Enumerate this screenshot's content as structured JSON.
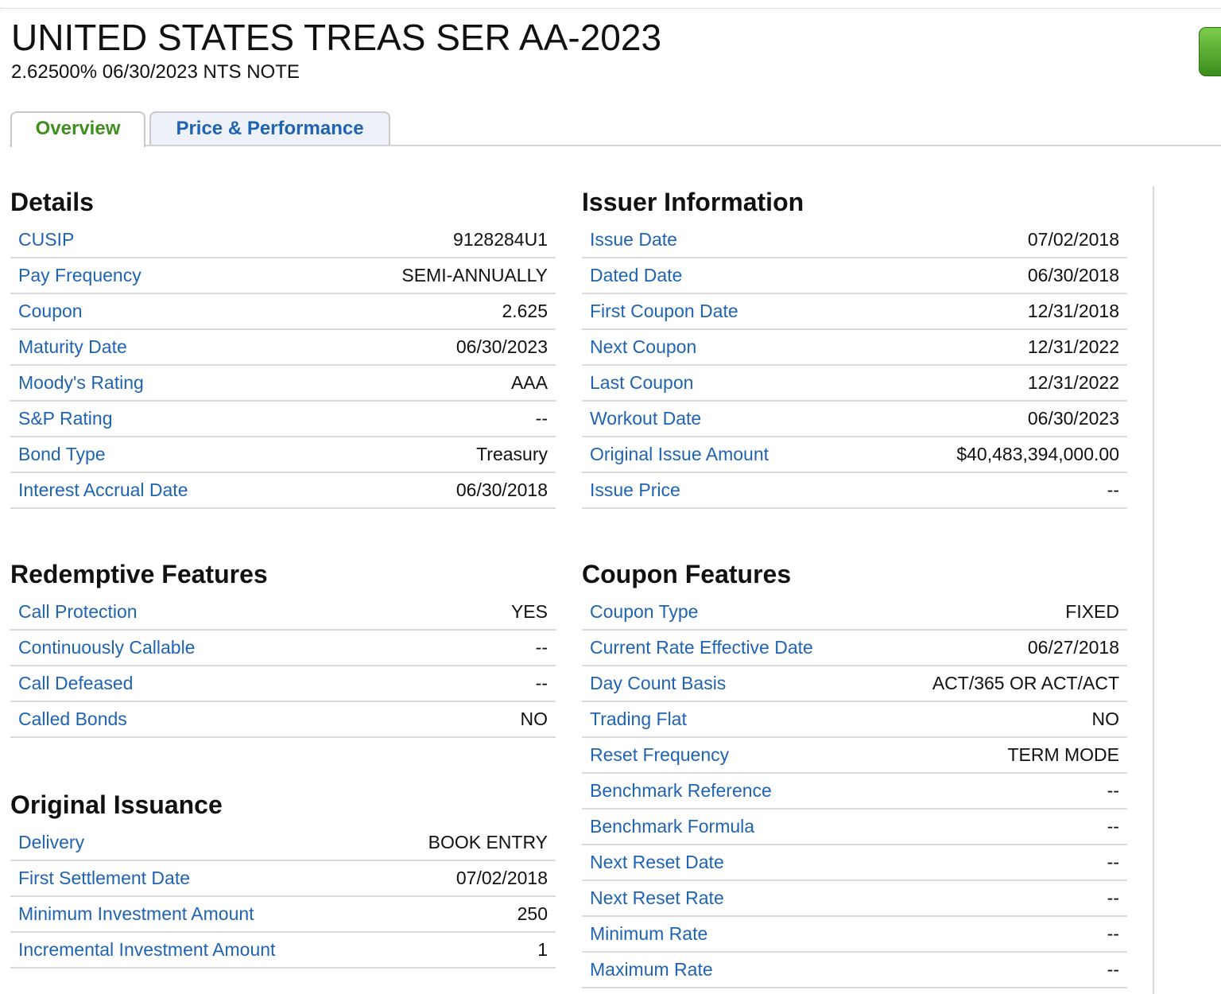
{
  "header": {
    "title": "UNITED STATES TREAS SER AA-2023",
    "subtitle": "2.62500% 06/30/2023 NTS NOTE"
  },
  "tabs": [
    {
      "label": "Overview",
      "active": true
    },
    {
      "label": "Price & Performance",
      "active": false
    }
  ],
  "details": {
    "heading": "Details",
    "rows": [
      {
        "label": "CUSIP",
        "value": "9128284U1"
      },
      {
        "label": "Pay Frequency",
        "value": "SEMI-ANNUALLY"
      },
      {
        "label": "Coupon",
        "value": "2.625"
      },
      {
        "label": "Maturity Date",
        "value": "06/30/2023"
      },
      {
        "label": "Moody's Rating",
        "value": "AAA"
      },
      {
        "label": "S&P Rating",
        "value": "--"
      },
      {
        "label": "Bond Type",
        "value": "Treasury"
      },
      {
        "label": "Interest Accrual Date",
        "value": "06/30/2018"
      }
    ]
  },
  "issuer": {
    "heading": "Issuer Information",
    "rows": [
      {
        "label": "Issue Date",
        "value": "07/02/2018"
      },
      {
        "label": "Dated Date",
        "value": "06/30/2018"
      },
      {
        "label": "First Coupon Date",
        "value": "12/31/2018"
      },
      {
        "label": "Next Coupon",
        "value": "12/31/2022"
      },
      {
        "label": "Last Coupon",
        "value": "12/31/2022"
      },
      {
        "label": "Workout Date",
        "value": "06/30/2023"
      },
      {
        "label": "Original Issue Amount",
        "value": "$40,483,394,000.00"
      },
      {
        "label": "Issue Price",
        "value": "--"
      }
    ]
  },
  "redemptive": {
    "heading": "Redemptive Features",
    "rows": [
      {
        "label": "Call Protection",
        "value": "YES"
      },
      {
        "label": "Continuously Callable",
        "value": "--"
      },
      {
        "label": "Call Defeased",
        "value": "--"
      },
      {
        "label": "Called Bonds",
        "value": "NO"
      }
    ]
  },
  "coupon": {
    "heading": "Coupon Features",
    "rows": [
      {
        "label": "Coupon Type",
        "value": "FIXED"
      },
      {
        "label": "Current Rate Effective Date",
        "value": "06/27/2018"
      },
      {
        "label": "Day Count Basis",
        "value": "ACT/365 OR ACT/ACT"
      },
      {
        "label": "Trading Flat",
        "value": "NO"
      },
      {
        "label": "Reset Frequency",
        "value": "TERM MODE"
      },
      {
        "label": "Benchmark Reference",
        "value": "--"
      },
      {
        "label": "Benchmark Formula",
        "value": "--"
      },
      {
        "label": "Next Reset Date",
        "value": "--"
      },
      {
        "label": "Next Reset Rate",
        "value": "--"
      },
      {
        "label": "Minimum Rate",
        "value": "--"
      },
      {
        "label": "Maximum Rate",
        "value": "--"
      }
    ]
  },
  "issuance": {
    "heading": "Original Issuance",
    "rows": [
      {
        "label": "Delivery",
        "value": "BOOK ENTRY"
      },
      {
        "label": "First Settlement Date",
        "value": "07/02/2018"
      },
      {
        "label": "Minimum Investment Amount",
        "value": "250"
      },
      {
        "label": "Incremental Investment Amount",
        "value": "1"
      }
    ]
  }
}
